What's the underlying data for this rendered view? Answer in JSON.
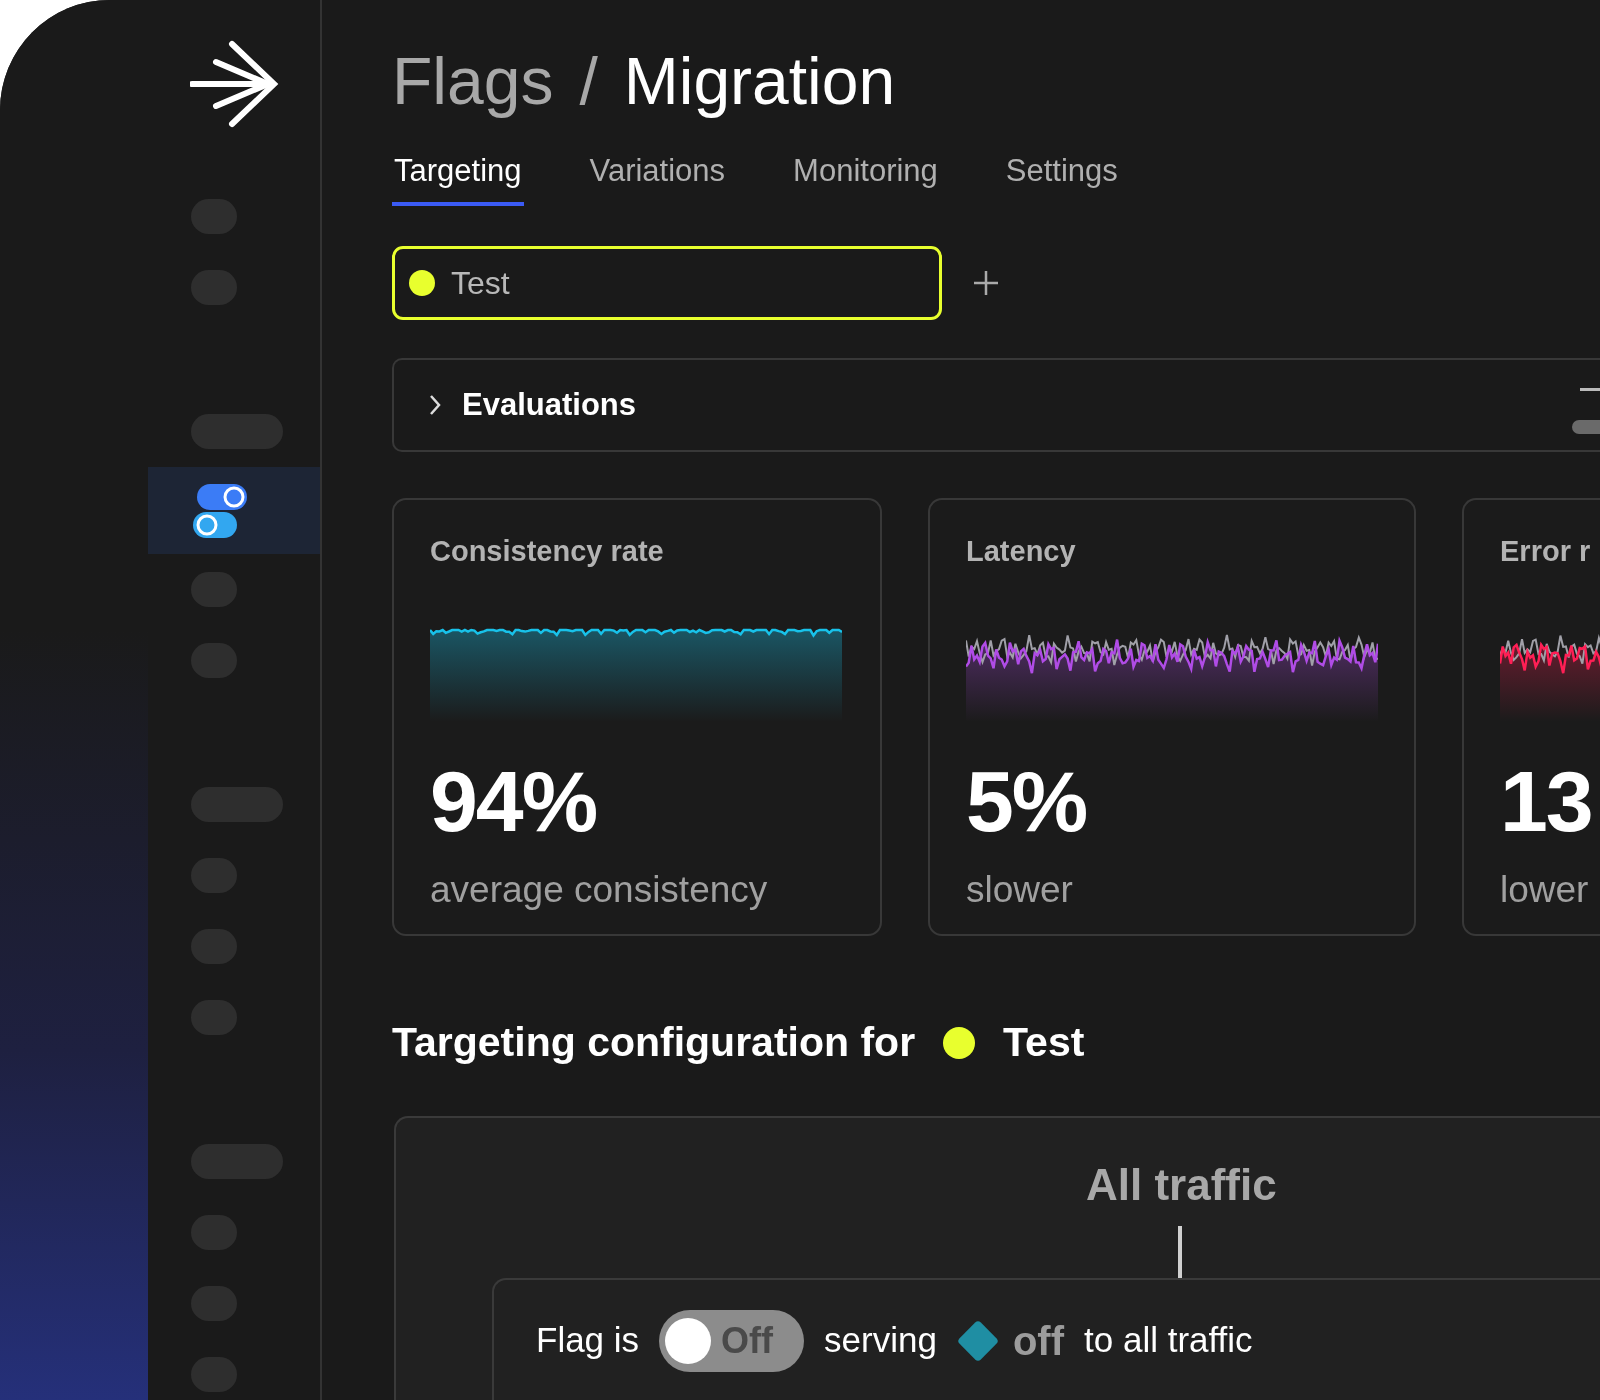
{
  "sidebar": {
    "groups": [
      {
        "items": [
          {
            "kind": "short",
            "selected": false
          },
          {
            "kind": "short",
            "selected": false
          }
        ]
      },
      {
        "items": [
          {
            "kind": "wide",
            "selected": false
          },
          {
            "kind": "toggle",
            "selected": true
          },
          {
            "kind": "short",
            "selected": false
          },
          {
            "kind": "short",
            "selected": false
          }
        ]
      },
      {
        "items": [
          {
            "kind": "wide",
            "selected": false
          },
          {
            "kind": "short",
            "selected": false
          },
          {
            "kind": "short",
            "selected": false
          },
          {
            "kind": "short",
            "selected": false
          }
        ]
      },
      {
        "items": [
          {
            "kind": "wide",
            "selected": false
          },
          {
            "kind": "short",
            "selected": false
          },
          {
            "kind": "short",
            "selected": false
          },
          {
            "kind": "short",
            "selected": false
          }
        ]
      }
    ]
  },
  "breadcrumb": {
    "parent": "Flags",
    "separator": "/",
    "current": "Migration"
  },
  "tabs": [
    {
      "label": "Targeting",
      "selected": true
    },
    {
      "label": "Variations",
      "selected": false
    },
    {
      "label": "Monitoring",
      "selected": false
    },
    {
      "label": "Settings",
      "selected": false
    }
  ],
  "environment": {
    "label": "Test",
    "color": "#e8ff2e"
  },
  "evaluations": {
    "title": "Evaluations",
    "expanded": false
  },
  "cards": [
    {
      "title": "Consistency rate",
      "value": "94%",
      "caption": "average consistency",
      "color": "#18c2ea",
      "kind": "single"
    },
    {
      "title": "Latency",
      "value": "5%",
      "caption": "slower",
      "color": "#b04ce6",
      "kind": "compare"
    },
    {
      "title": "Error r",
      "value": "13",
      "caption": "lower",
      "color": "#ff1f55",
      "kind": "compare"
    }
  ],
  "targeting": {
    "heading": "Targeting configuration for",
    "environment": {
      "label": "Test",
      "color": "#e8ff2e"
    },
    "rule_title": "All traffic",
    "flag_row": {
      "prefix": "Flag is",
      "toggle": {
        "on": false,
        "label": "Off"
      },
      "middle": "serving",
      "variation": {
        "label": "off",
        "color": "#1f8ea3"
      },
      "suffix": "to all traffic"
    }
  }
}
